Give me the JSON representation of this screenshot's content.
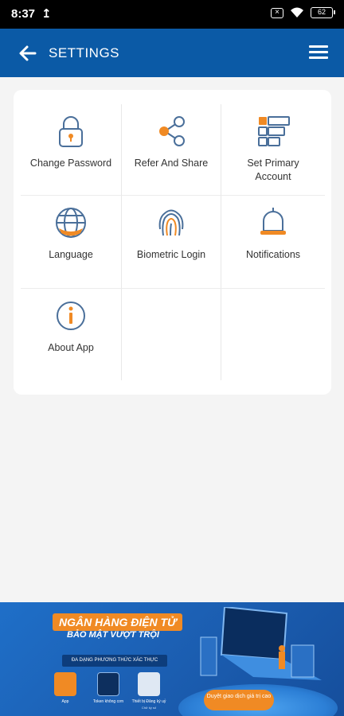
{
  "status_bar": {
    "time": "8:37",
    "upload_icon": "upload-arrow-icon",
    "battery": "62"
  },
  "header": {
    "title": "SETTINGS",
    "back_icon": "arrow-left-icon",
    "menu_icon": "hamburger-menu-icon"
  },
  "settings": {
    "items": [
      {
        "label": "Change Password",
        "icon": "padlock-icon"
      },
      {
        "label": "Refer And Share",
        "icon": "share-icon"
      },
      {
        "label": "Set Primary Account",
        "icon": "account-list-icon"
      },
      {
        "label": "Language",
        "icon": "globe-icon"
      },
      {
        "label": "Biometric Login",
        "icon": "fingerprint-icon"
      },
      {
        "label": "Notifications",
        "icon": "bell-icon"
      },
      {
        "label": "About App",
        "icon": "info-icon"
      }
    ]
  },
  "banner": {
    "headline": "NGÂN HÀNG ĐIỆN TỬ",
    "subheadline": "BẢO MẬT VƯỢT TRỘI",
    "methods_title": "ĐA DẠNG PHƯƠNG THỨC XÁC THỰC",
    "methods": [
      {
        "label": "App",
        "caption": ""
      },
      {
        "label": "Token không cơn",
        "caption": ""
      },
      {
        "label": "Thiết bị Đăng ký uỷ",
        "caption": "Chữ ký số"
      }
    ],
    "tagline": "Duyệt giao dịch giá trị cao",
    "colors": {
      "accent": "#f08a24",
      "brand": "#0b5aa6"
    }
  }
}
